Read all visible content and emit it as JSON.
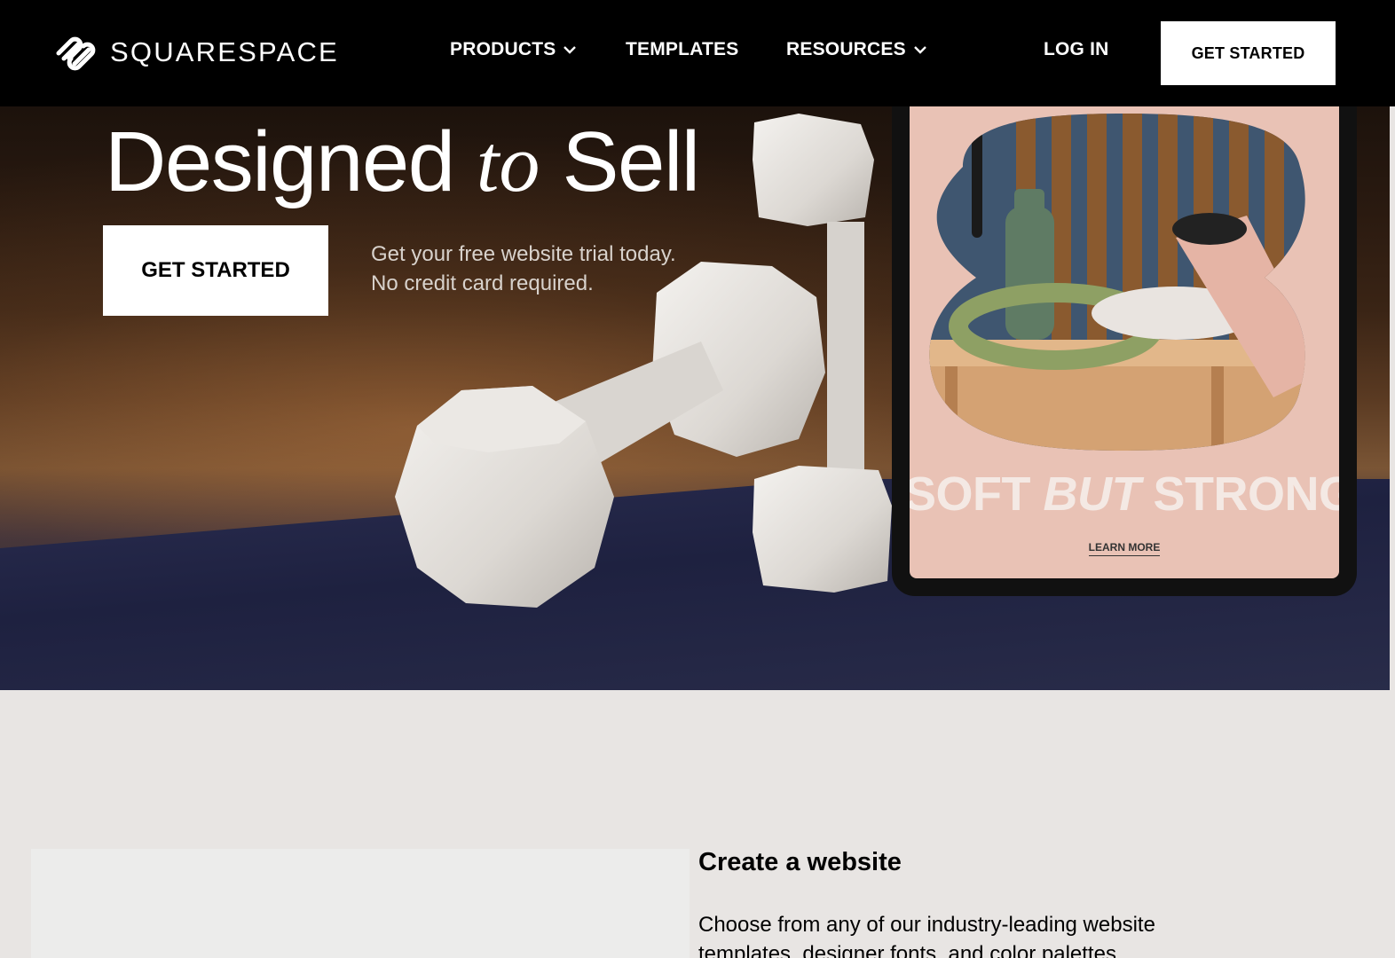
{
  "nav": {
    "logo_text": "SQUARESPACE",
    "logo_icon": "squarespace-logo-icon",
    "items": [
      {
        "label": "PRODUCTS",
        "has_dropdown": true
      },
      {
        "label": "TEMPLATES",
        "has_dropdown": false
      },
      {
        "label": "RESOURCES",
        "has_dropdown": true
      }
    ],
    "login": "LOG IN",
    "cta": "GET STARTED"
  },
  "hero": {
    "title_part1": "Designed",
    "title_italic": "to",
    "title_part2": "Sell",
    "cta": "GET STARTED",
    "sub_line1": "Get your free website trial today.",
    "sub_line2": "No credit card required.",
    "tablet": {
      "headline_part1": "SOFT",
      "headline_italic": "BUT",
      "headline_part2": "STRONG",
      "link": "LEARN MORE"
    }
  },
  "section": {
    "title": "Create a website",
    "body": "Choose from any of our industry-leading website templates, designer fonts, and color palettes"
  },
  "colors": {
    "nav_bg": "#000000",
    "cta_bg": "#ffffff",
    "page_bg": "#e8e5e3",
    "tablet_bg": "#e9c2b5"
  }
}
